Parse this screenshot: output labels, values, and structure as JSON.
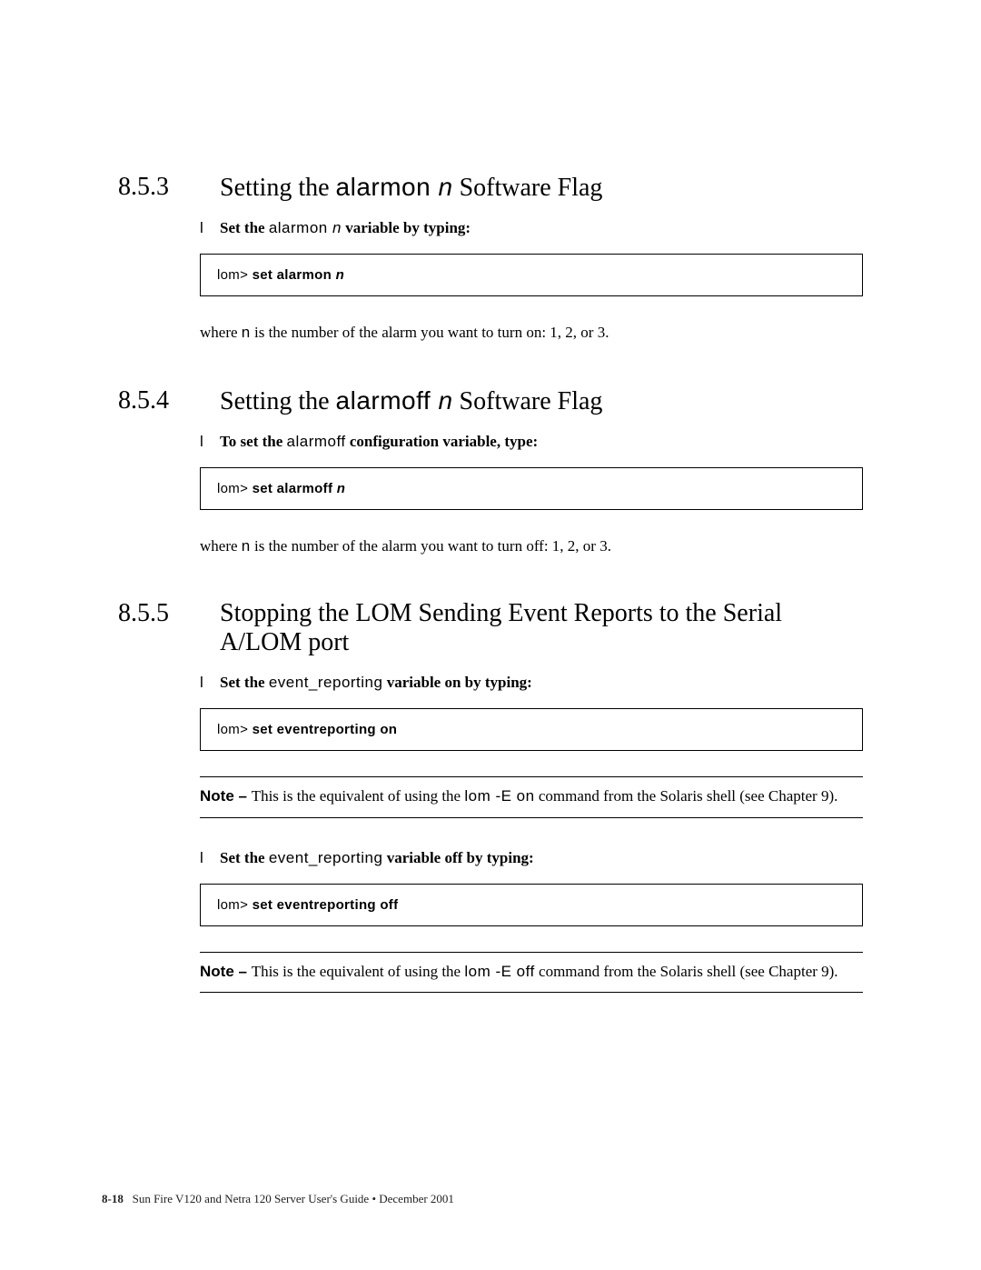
{
  "sections": {
    "s1": {
      "num": "8.5.3",
      "title_before": "Setting the ",
      "title_mono": "alarmon ",
      "title_italic": "n",
      "title_after": " Software Flag",
      "bullet_before": "Set the ",
      "bullet_mono": "alarmon ",
      "bullet_italic": "n",
      "bullet_after": " variable by typing:",
      "code_lead": "lom> ",
      "code_cmd": "set alarmon ",
      "code_arg": "n",
      "para_before": "where ",
      "para_mono": "n",
      "para_after": " is the number of the alarm you want to turn on: 1, 2, or 3."
    },
    "s2": {
      "num": "8.5.4",
      "title_before": "Setting the ",
      "title_mono": "alarmoff ",
      "title_italic": "n",
      "title_after": " Software Flag",
      "bullet_before": "To set the ",
      "bullet_mono": "alarmoff",
      "bullet_after": " configuration variable, type:",
      "code_lead": "lom> ",
      "code_cmd": "set alarmoff ",
      "code_arg": "n",
      "para_before": "where ",
      "para_mono": "n",
      "para_after": " is the number of the alarm you want to turn off: 1, 2, or 3."
    },
    "s3": {
      "num": "8.5.5",
      "title": "Stopping the LOM Sending Event Reports to the Serial A/LOM port",
      "bullet1_before": "Set the ",
      "bullet1_mono": "event_reporting",
      "bullet1_after": " variable on by typing:",
      "code1_lead": "lom> ",
      "code1_cmd": "set eventreporting on",
      "note1_bold": "Note – ",
      "note1_before": "This is the equivalent of using the ",
      "note1_mono": "lom -E on",
      "note1_after": " command from the Solaris shell (see Chapter 9).",
      "bullet2_before": "Set the ",
      "bullet2_mono": "event_reporting",
      "bullet2_after": " variable off by typing:",
      "code2_lead": "lom> ",
      "code2_cmd": "set eventreporting off",
      "note2_bold": "Note – ",
      "note2_before": "This is the equivalent of using the ",
      "note2_mono": "lom -E off",
      "note2_after": " command from the Solaris shell (see Chapter 9)."
    }
  },
  "footer": {
    "page": "8-18",
    "text": "Sun Fire V120 and Netra 120 Server User's Guide • December 2001"
  }
}
